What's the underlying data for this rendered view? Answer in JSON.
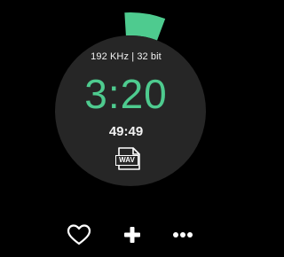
{
  "player": {
    "audio_format": "192 KHz | 32 bit",
    "elapsed_time": "3:20",
    "total_time": "49:49",
    "file_type_label": "WAV",
    "progress_fraction": 0.067,
    "colors": {
      "background": "#000000",
      "dial": "#262626",
      "accent": "#4ecb8f",
      "text": "#f2f2f2"
    }
  },
  "actions": {
    "like_icon": "heart-icon",
    "add_icon": "plus-icon",
    "more_icon": "more-icon"
  }
}
